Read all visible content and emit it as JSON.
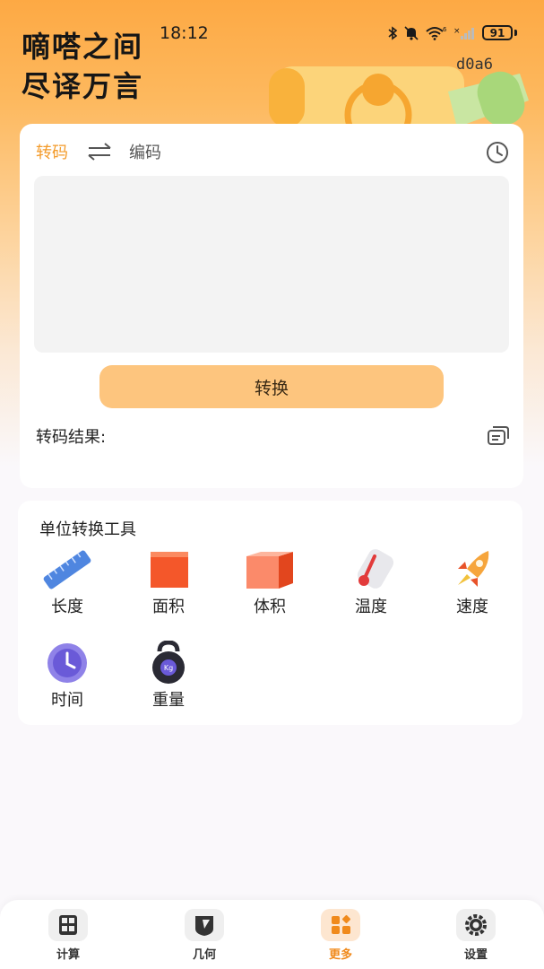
{
  "status_bar": {
    "time": "18:12",
    "network_label": "6",
    "battery": "91"
  },
  "header": {
    "title_line1": "嘀嗒之间",
    "title_line2": "尽译万言",
    "hash": "d0a6"
  },
  "converter": {
    "tab_active": "转码",
    "tab_inactive": "编码",
    "input_value": "",
    "convert_label": "转换",
    "result_label": "转码结果:",
    "accent_color": "#f39b2a",
    "button_color": "#fdc57e"
  },
  "tools": {
    "title": "单位转换工具",
    "items": [
      {
        "label": "长度",
        "icon": "ruler-icon"
      },
      {
        "label": "面积",
        "icon": "square-icon"
      },
      {
        "label": "体积",
        "icon": "cube-icon"
      },
      {
        "label": "温度",
        "icon": "thermometer-icon"
      },
      {
        "label": "速度",
        "icon": "rocket-icon"
      },
      {
        "label": "时间",
        "icon": "clock-icon"
      },
      {
        "label": "重量",
        "icon": "kettlebell-icon"
      }
    ]
  },
  "bottom_nav": {
    "items": [
      {
        "label": "计算",
        "icon": "calculator-icon",
        "active": false
      },
      {
        "label": "几何",
        "icon": "geometry-icon",
        "active": false
      },
      {
        "label": "更多",
        "icon": "grid-more-icon",
        "active": true
      },
      {
        "label": "设置",
        "icon": "gear-icon",
        "active": false
      }
    ],
    "active_color": "#f08a1c"
  }
}
